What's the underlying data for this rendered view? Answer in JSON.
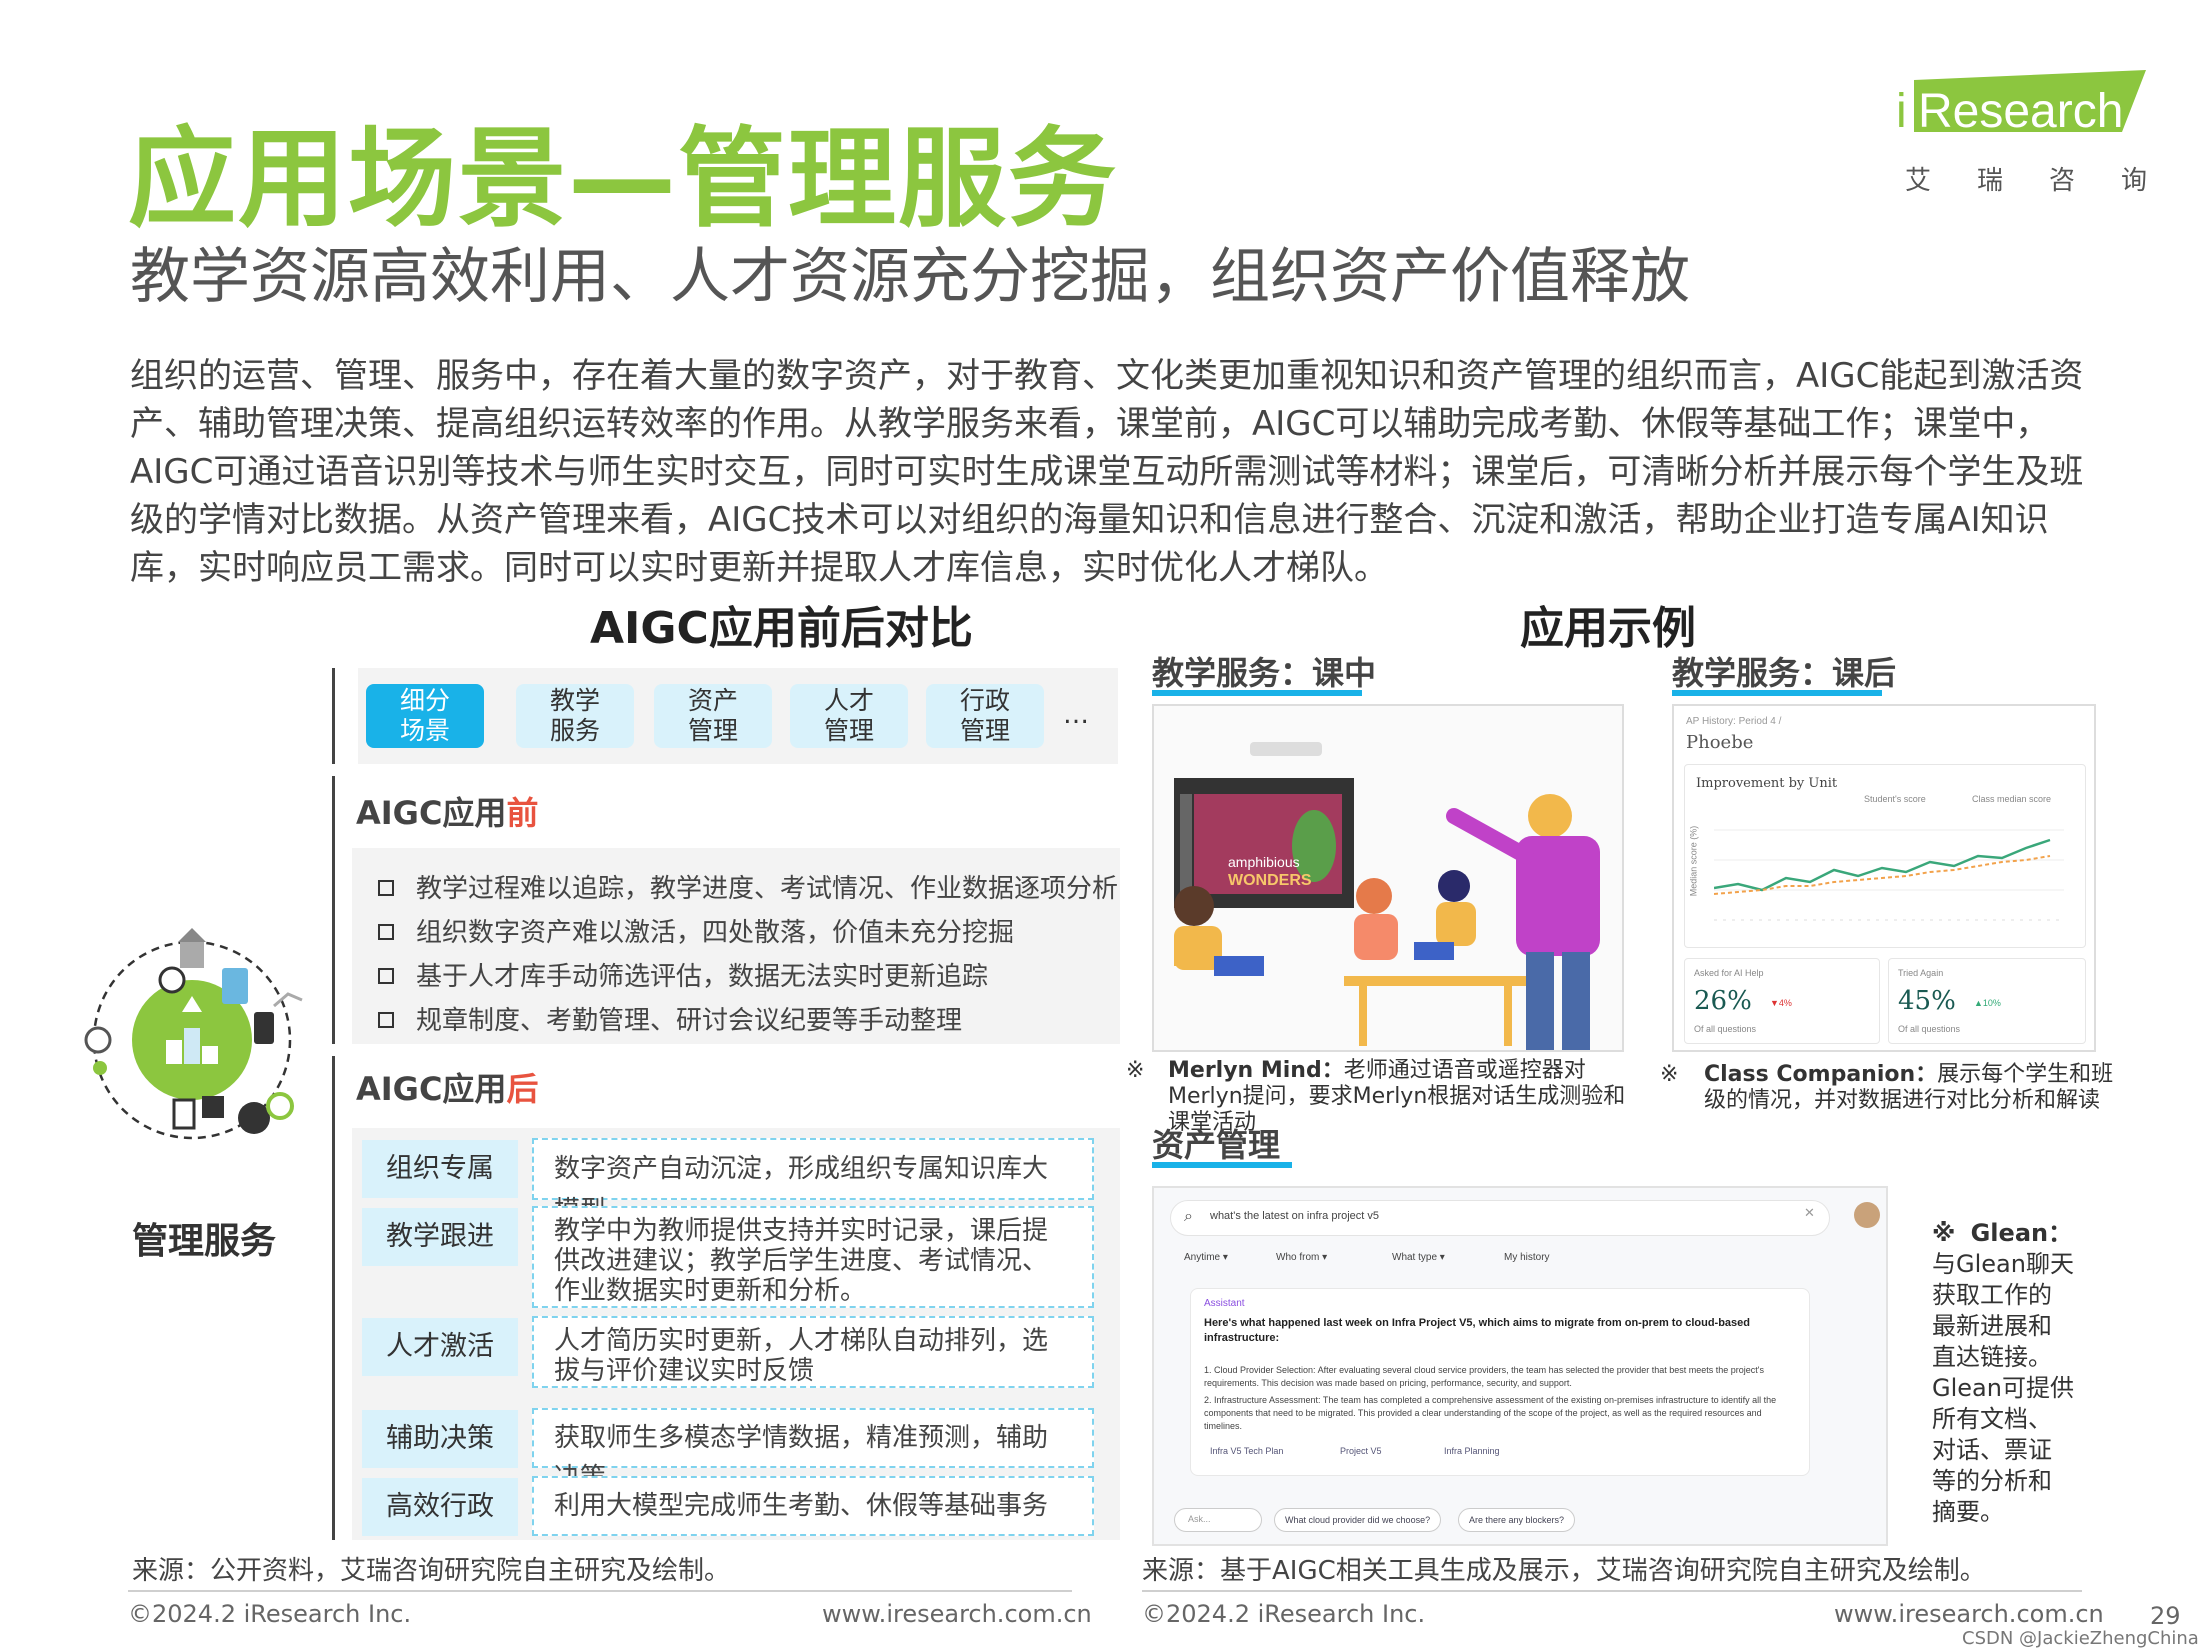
{
  "header": {
    "title": "应用场景—管理服务",
    "subtitle": "教学资源高效利用、人才资源充分挖掘，组织资产价值释放",
    "logo_text": "Research",
    "logo_i": "i",
    "logo_cn": "艾瑞咨询"
  },
  "intro": "组织的运营、管理、服务中，存在着大量的数字资产，对于教育、文化类更加重视知识和资产管理的组织而言，AIGC能起到激活资产、辅助管理决策、提高组织运转效率的作用。从教学服务来看，课堂前，AIGC可以辅助完成考勤、休假等基础工作；课堂中，AIGC可通过语音识别等技术与师生实时交互，同时可实时生成课堂互动所需测试等材料；课堂后，可清晰分析并展示每个学生及班级的学情对比数据。从资产管理来看，AIGC技术可以对组织的海量知识和信息进行整合、沉淀和激活，帮助企业打造专属AI知识库，实时响应员工需求。同时可以实时更新并提取人才库信息，实时优化人才梯队。",
  "comparison": {
    "title": "AIGC应用前后对比",
    "tabs": [
      {
        "l1": "细分",
        "l2": "场景"
      },
      {
        "l1": "教学",
        "l2": "服务"
      },
      {
        "l1": "资产",
        "l2": "管理"
      },
      {
        "l1": "人才",
        "l2": "管理"
      },
      {
        "l1": "行政",
        "l2": "管理"
      }
    ],
    "tabs_more": "…",
    "before_label": "AIGC应用",
    "before_label_red": "前",
    "before_items": [
      "教学过程难以追踪，教学进度、考试情况、作业数据逐项分析",
      "组织数字资产难以激活，四处散落，价值未充分挖掘",
      "基于人才库手动筛选评估，数据无法实时更新追踪",
      "规章制度、考勤管理、研讨会议纪要等手动整理"
    ],
    "after_label": "AIGC应用",
    "after_label_red": "后",
    "after_rows": [
      {
        "label": "组织专属",
        "desc": "数字资产自动沉淀，形成组织专属知识库大模型"
      },
      {
        "label": "教学跟进",
        "desc": "教学中为教师提供支持并实时记录，课后提供改进建议；教学后学生进度、考试情况、作业数据实时更新和分析。"
      },
      {
        "label": "人才激活",
        "desc": "人才简历实时更新，人才梯队自动排列，选拔与评价建议实时反馈"
      },
      {
        "label": "辅助决策",
        "desc": "获取师生多模态学情数据，精准预测，辅助决策"
      },
      {
        "label": "高效行政",
        "desc": "利用大模型完成师生考勤、休假等基础事务"
      }
    ],
    "scene_label": "管理服务"
  },
  "examples": {
    "title": "应用示例",
    "in_class": {
      "heading": "教学服务：课中",
      "slide_text1": "amphibious",
      "slide_text2": "WONDERS",
      "caption_mark": "※",
      "caption_name": "Merlyn Mind：",
      "caption_text": "老师通过语音或遥控器对Merlyn提问，要求Merlyn根据对话生成测验和课堂活动"
    },
    "after_class": {
      "heading": "教学服务：课后",
      "breadcrumb": "AP History: Period 4 /",
      "student": "Phoebe",
      "chart_title": "Improvement by Unit",
      "legend1": "Student's score",
      "legend2": "Class median score",
      "ylabel": "Median score (%)",
      "stat1_label": "Asked for AI Help",
      "stat1_value": "26%",
      "stat1_delta": "▼4%",
      "stat1_sub": "Of all questions",
      "stat2_label": "Tried Again",
      "stat2_value": "45%",
      "stat2_delta": "▲10%",
      "stat2_sub": "Of all questions",
      "caption_mark": "※",
      "caption_name": "Class Companion：",
      "caption_text": "展示每个学生和班级的情况，并对数据进行对比分析和解读"
    },
    "asset": {
      "heading": "资产管理",
      "search_query": "what's the latest on infra project v5",
      "filters": [
        "Anytime ▾",
        "Who from ▾",
        "What type ▾",
        "My history"
      ],
      "assistant_label": "Assistant",
      "answer_lead": "Here's what happened last week on Infra Project V5, which aims to migrate from on-prem to cloud-based infrastructure:",
      "answer_1": "1. Cloud Provider Selection: After evaluating several cloud service providers, the team has selected the provider that best meets the project's requirements. This decision was made based on pricing, performance, security, and support.",
      "answer_2": "2. Infrastructure Assessment: The team has completed a comprehensive assessment of the existing on-premises infrastructure to identify all the components that need to be migrated. This provided a clear understanding of the scope of the project, as well as the required resources and timelines.",
      "chips": [
        "Infra V5 Tech Plan",
        "Project V5",
        "Infra Planning"
      ],
      "ask_placeholder": "Ask...",
      "suggest1": "What cloud provider did we choose?",
      "suggest2": "Are there any blockers?",
      "caption_mark": "※",
      "caption_name": "Glean：",
      "caption_lines": [
        "与Glean聊天",
        "获取工作的",
        "最新进展和",
        "直达链接。",
        "Glean可提供",
        "所有文档、",
        "对话、票证",
        "等的分析和",
        "摘要。"
      ]
    }
  },
  "sources": {
    "left": "来源：公开资料，艾瑞咨询研究院自主研究及绘制。",
    "right": "来源：基于AIGC相关工具生成及展示，艾瑞咨询研究院自主研究及绘制。"
  },
  "footer": {
    "copyright_left": "©2024.2 iResearch Inc.",
    "url_left": "www.iresearch.com.cn",
    "copyright_right": "©2024.2 iResearch Inc.",
    "url_right": "www.iresearch.com.cn",
    "page": "29",
    "watermark": "CSDN @JackieZhengChina"
  },
  "colors": {
    "title_green": "#8cc63f",
    "accent_blue": "#19b2e8",
    "light_blue": "#d9f2fb",
    "highlight_red": "#e8533f"
  }
}
